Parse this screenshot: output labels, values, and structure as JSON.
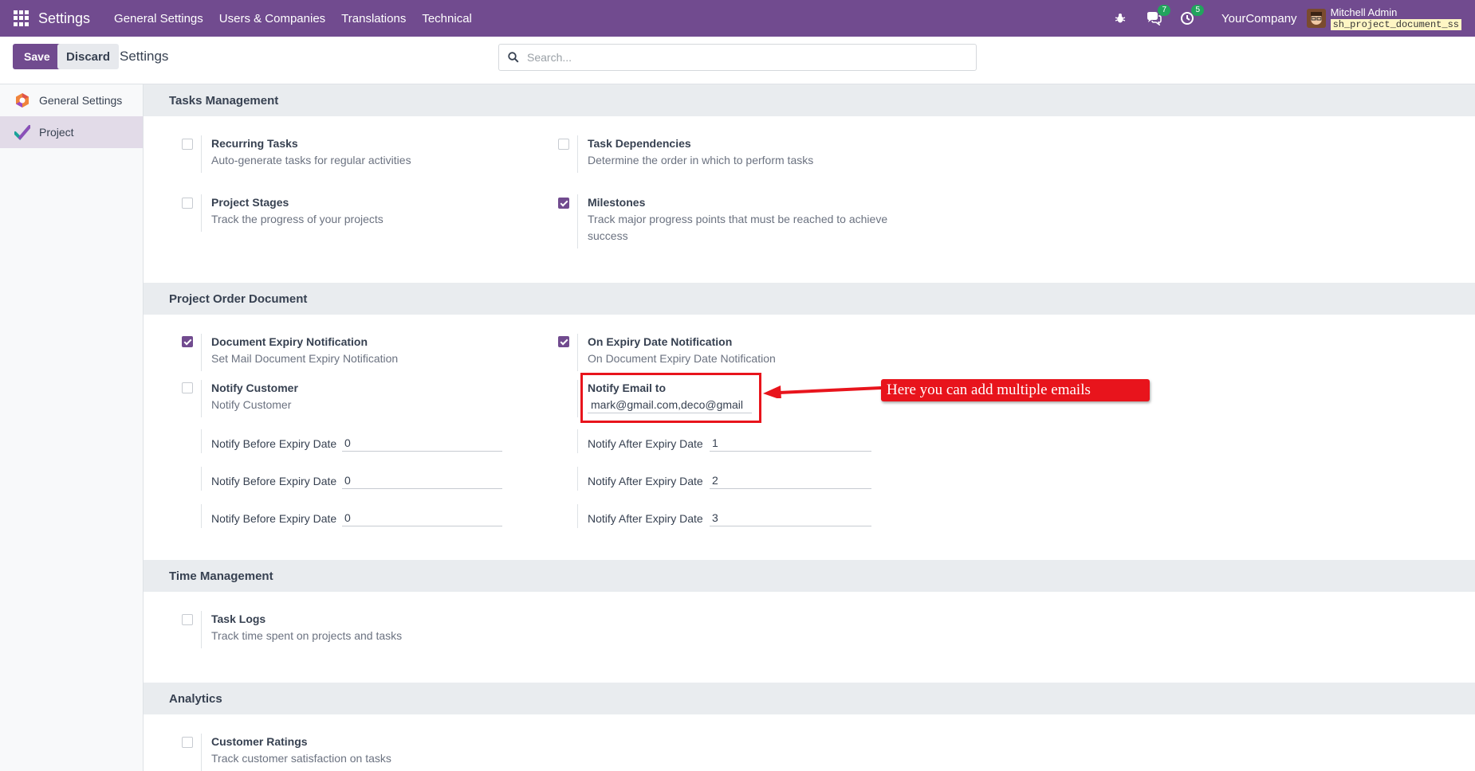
{
  "navbar": {
    "app_title": "Settings",
    "menu": [
      "General Settings",
      "Users & Companies",
      "Translations",
      "Technical"
    ],
    "messages_count": "7",
    "activities_count": "5",
    "company": "YourCompany",
    "user_name": "Mitchell Admin",
    "database": "sh_project_document_ss",
    "accent_color": "#714b8f",
    "icons": [
      "apps-grid-icon",
      "bug-icon",
      "chat-icon",
      "clock-icon",
      "avatar"
    ]
  },
  "control_panel": {
    "save_label": "Save",
    "discard_label": "Discard",
    "title": "Settings",
    "search_placeholder": "Search..."
  },
  "sidebar": {
    "items": [
      {
        "label": "General Settings",
        "icon": "general-settings-icon",
        "active": false
      },
      {
        "label": "Project",
        "icon": "project-checkmark-icon",
        "active": true
      }
    ]
  },
  "tasks_management": {
    "header": "Tasks Management",
    "recurring": {
      "title": "Recurring Tasks",
      "desc": "Auto-generate tasks for regular activities",
      "checked": false
    },
    "dependencies": {
      "title": "Task Dependencies",
      "desc": "Determine the order in which to perform tasks",
      "checked": false
    },
    "stages": {
      "title": "Project Stages",
      "desc": "Track the progress of your projects",
      "checked": false
    },
    "milestones": {
      "title": "Milestones",
      "desc": "Track major progress points that must be reached to achieve success",
      "checked": true
    }
  },
  "project_order_document": {
    "header": "Project Order Document",
    "expiry_notification": {
      "title": "Document Expiry Notification",
      "desc": "Set Mail Document Expiry Notification",
      "checked": true
    },
    "on_expiry_notification": {
      "title": "On Expiry Date Notification",
      "desc": "On Document Expiry Date Notification",
      "checked": true
    },
    "notify_customer": {
      "title": "Notify Customer",
      "desc": "Notify Customer",
      "checked": false
    },
    "notify_email": {
      "title": "Notify Email to",
      "value": "mark@gmail.com,deco@gmail"
    },
    "before_label": "Notify Before Expiry Date",
    "after_label": "Notify After Expiry Date",
    "before_values": [
      "0",
      "0",
      "0"
    ],
    "after_values": [
      "1",
      "2",
      "3"
    ]
  },
  "time_management": {
    "header": "Time Management",
    "task_logs": {
      "title": "Task Logs",
      "desc": "Track time spent on projects and tasks",
      "checked": false
    }
  },
  "analytics": {
    "header": "Analytics",
    "ratings": {
      "title": "Customer Ratings",
      "desc": "Track customer satisfaction on tasks",
      "checked": false
    }
  },
  "annotation": {
    "callout_text": "Here you can add multiple emails",
    "color": "#e8141c"
  }
}
